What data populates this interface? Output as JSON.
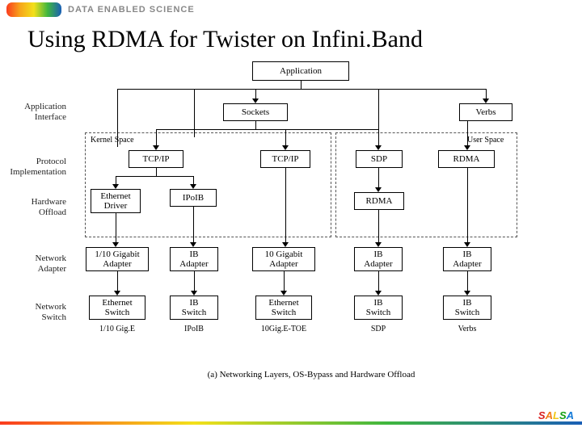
{
  "banner": {
    "text": "DATA ENABLED SCIENCE"
  },
  "title": "Using RDMA for Twister on Infini.Band",
  "row_labels": {
    "app_iface": "Application\nInterface",
    "proto": "Protocol\nImplementation",
    "hw": "Hardware\nOffload",
    "net_adapter": "Network\nAdapter",
    "net_switch": "Network\nSwitch"
  },
  "space_labels": {
    "kernel": "Kernel Space",
    "user": "User Space"
  },
  "boxes": {
    "application": "Application",
    "sockets": "Sockets",
    "verbs": "Verbs",
    "tcpip_a": "TCP/IP",
    "tcpip_b": "TCP/IP",
    "sdp": "SDP",
    "rdma_top": "RDMA",
    "ethernet_driver": "Ethernet\nDriver",
    "ipoib": "IPoIB",
    "rdma_mid": "RDMA",
    "adp1": "1/10 Gigabit\nAdapter",
    "adp2": "IB\nAdapter",
    "adp3": "10 Gigabit\nAdapter",
    "adp4": "IB\nAdapter",
    "adp5": "IB\nAdapter",
    "sw1": "Ethernet\nSwitch",
    "sw2": "IB\nSwitch",
    "sw3": "Ethernet\nSwitch",
    "sw4": "IB\nSwitch",
    "sw5": "IB\nSwitch"
  },
  "columns": {
    "c1": "1/10 Gig.E",
    "c2": "IPoIB",
    "c3": "10Gig.E-TOE",
    "c4": "SDP",
    "c5": "Verbs"
  },
  "caption": "(a) Networking Layers, OS-Bypass and Hardware Offload",
  "footer_logo": "SALSA"
}
